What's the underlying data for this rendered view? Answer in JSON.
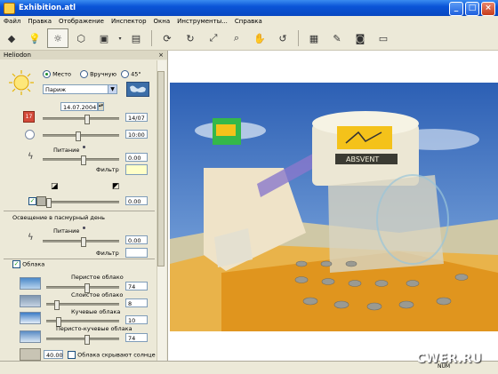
{
  "window": {
    "title": "Exhibition.atl",
    "minimize": "_",
    "maximize": "□",
    "close": "×"
  },
  "menu": [
    "Файл",
    "Правка",
    "Отображение",
    "Инспектор",
    "Окна",
    "Инструменты...",
    "Справка"
  ],
  "panel": {
    "title": "Heliodon",
    "close": "×",
    "mode": {
      "options": [
        "Место",
        "Вручную",
        "45°"
      ],
      "selected": "Место"
    },
    "city": "Париж",
    "date": "14.07.2004",
    "date_value": "14/07",
    "time_value": "10:00",
    "power_label": "Питание",
    "power_value": "0.00",
    "filter_label": "Фильтр",
    "shadow_value": "0.00",
    "overcast_title": "Освещение в пасмурный день",
    "overcast_power_label": "Питание",
    "overcast_power_value": "0.00",
    "overcast_filter_label": "Фильтр",
    "clouds_label": "Облака",
    "clouds_checked": true,
    "cloud_rows": [
      {
        "label": "Перистое облако",
        "value": "74",
        "level": 0.55
      },
      {
        "label": "Слоистое облако",
        "value": "8",
        "level": 0.12
      },
      {
        "label": "Кучевые облака",
        "value": "10",
        "level": 0.14
      },
      {
        "label": "Перисто-кучевые облака",
        "value": "74",
        "level": 0.55
      }
    ],
    "bottom_value": "40.00",
    "clouds_shadow_label": "Облака скрывают солнце"
  },
  "scene": {
    "sign_text": "ABSVENT"
  },
  "status": {
    "num": "NUM"
  },
  "watermark": "CWER.RU"
}
